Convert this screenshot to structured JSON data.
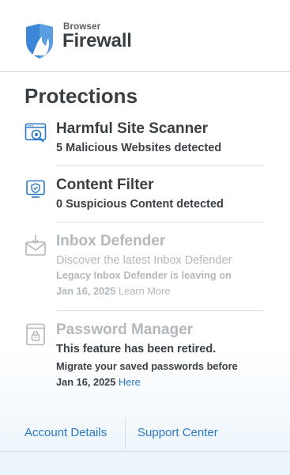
{
  "header": {
    "brand_small": "Browser",
    "brand_big": "Firewall",
    "colors": {
      "logo_blue": "#3b86d6",
      "logo_light": "#a8cdf0"
    }
  },
  "main": {
    "section_title": "Protections",
    "items": [
      {
        "icon": "site-scanner-icon",
        "title": "Harmful Site Scanner",
        "desc": "5 Malicious Websites detected"
      },
      {
        "icon": "content-filter-icon",
        "title": "Content Filter",
        "desc": "0 Suspicious Content detected"
      },
      {
        "icon": "inbox-defender-icon",
        "title": "Inbox Defender",
        "desc": "Discover the latest Inbox Defender",
        "note_line1": "Legacy Inbox Defender is leaving on",
        "note_line2": "Jan 16, 2025",
        "link": "Learn More"
      },
      {
        "icon": "password-manager-icon",
        "title": "Password Manager",
        "desc": "This feature has been retired.",
        "note_line1": "Migrate your saved passwords before",
        "note_line2": "Jan 16, 2025",
        "link": "Here"
      }
    ]
  },
  "footer": {
    "account_label": "Account Details",
    "support_label": "Support Center"
  },
  "colors": {
    "accent": "#2b78c5",
    "text": "#3a3f44",
    "disabled": "#b3b8bc"
  }
}
